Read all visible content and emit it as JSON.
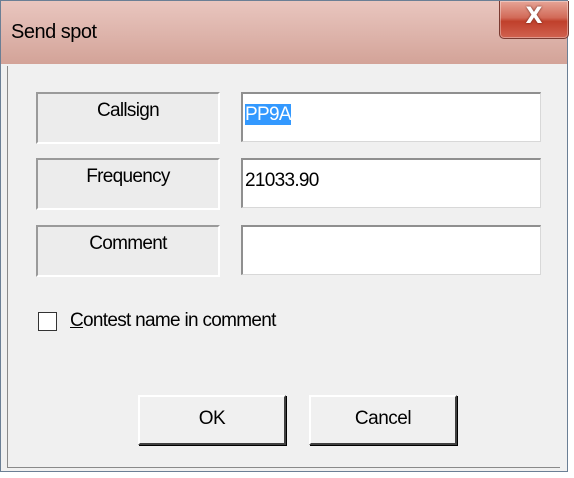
{
  "window": {
    "title": "Send spot",
    "close_glyph": "X",
    "close_icon": "close-icon"
  },
  "fields": {
    "callsign": {
      "label": "Callsign",
      "value": "PP9A"
    },
    "frequency": {
      "label": "Frequency",
      "value": "21033.90"
    },
    "comment": {
      "label": "Comment",
      "value": ""
    }
  },
  "options": {
    "contest_name": {
      "label_underlined": "C",
      "label_rest": "ontest name in comment",
      "checked": false
    }
  },
  "buttons": {
    "ok": "OK",
    "cancel": "Cancel"
  },
  "colors": {
    "titlebar": "#dcb3aa",
    "close_button": "#c9503d",
    "selection": "#3399ff",
    "dialog_bg": "#f0f0f0"
  }
}
